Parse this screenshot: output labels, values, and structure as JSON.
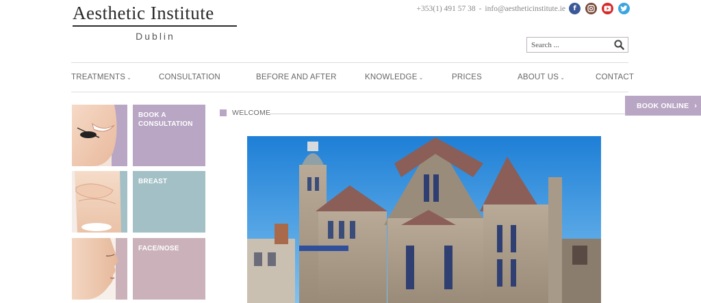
{
  "brand": {
    "title": "Aesthetic Institute",
    "subtitle": "Dublin"
  },
  "contact": {
    "phone": "+353(1) 491 57 38",
    "separator": "-",
    "email": "info@aestheticinstitute.ie"
  },
  "social": [
    {
      "name": "facebook",
      "glyph": "f",
      "color": "#3b5998"
    },
    {
      "name": "instagram",
      "glyph": "◙",
      "color": "#7a4b3a"
    },
    {
      "name": "youtube",
      "glyph": "▶",
      "color": "#d62a2a"
    },
    {
      "name": "twitter",
      "glyph": "t",
      "color": "#3aa5e0"
    }
  ],
  "search": {
    "placeholder": "Search ...",
    "icon": "search-icon"
  },
  "nav": [
    {
      "label": "TREATMENTS",
      "dropdown": true
    },
    {
      "label": "CONSULTATION",
      "dropdown": false
    },
    {
      "label": "BEFORE AND AFTER",
      "dropdown": false
    },
    {
      "label": "KNOWLEDGE",
      "dropdown": true
    },
    {
      "label": "PRICES",
      "dropdown": false
    },
    {
      "label": "ABOUT US",
      "dropdown": true
    },
    {
      "label": "CONTACT",
      "dropdown": false
    }
  ],
  "book_online": {
    "label": "BOOK ONLINE",
    "arrow": "›"
  },
  "tiles": [
    {
      "label": "BOOK A CONSULTATION",
      "color": "#b8a6c4"
    },
    {
      "label": "BREAST",
      "color": "#a2c0c5"
    },
    {
      "label": "FACE/NOSE",
      "color": "#cbb2ba"
    }
  ],
  "welcome": {
    "label": "WELCOME"
  },
  "colors": {
    "accent_purple": "#b8a6c4",
    "accent_teal": "#a2c0c5",
    "accent_pink": "#cbb2ba"
  }
}
